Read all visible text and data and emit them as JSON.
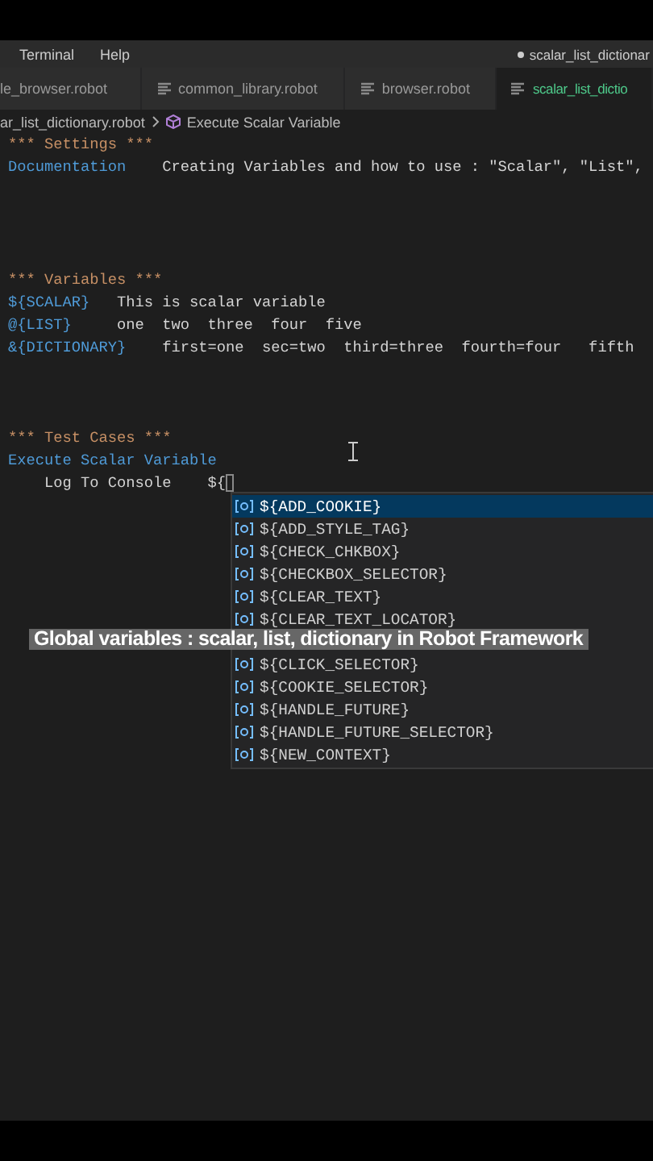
{
  "menu": [
    "Terminal",
    "Help"
  ],
  "window": {
    "title": "scalar_list_dictionar",
    "modified": true
  },
  "tabs": [
    {
      "label": "le_browser.robot",
      "icon": false,
      "selected": false
    },
    {
      "label": "common_library.robot",
      "icon": true,
      "selected": false
    },
    {
      "label": "browser.robot",
      "icon": true,
      "selected": false
    },
    {
      "label": "scalar_list_dictio",
      "icon": true,
      "selected": true
    }
  ],
  "breadcrumb": {
    "file": "ar_list_dictionary.robot",
    "symbol": "Execute Scalar Variable"
  },
  "editor": {
    "lines": [
      {
        "kind": "code",
        "tokens": [
          {
            "kind": "header",
            "text": "*** Settings ***"
          }
        ]
      },
      {
        "kind": "code",
        "tokens": [
          {
            "kind": "name",
            "text": "Documentation"
          },
          {
            "kind": "plain",
            "text": "    Creating Variables and how to use : \"Scalar\", \"List\","
          }
        ]
      },
      {
        "kind": "blank"
      },
      {
        "kind": "blank"
      },
      {
        "kind": "blank"
      },
      {
        "kind": "blank"
      },
      {
        "kind": "code",
        "tokens": [
          {
            "kind": "header",
            "text": "*** Variables ***"
          }
        ]
      },
      {
        "kind": "code",
        "tokens": [
          {
            "kind": "name",
            "text": "${SCALAR}"
          },
          {
            "kind": "plain",
            "text": "   This is scalar variable"
          }
        ]
      },
      {
        "kind": "code",
        "tokens": [
          {
            "kind": "name",
            "text": "@{LIST}"
          },
          {
            "kind": "plain",
            "text": "     one  two  three  four  five"
          }
        ]
      },
      {
        "kind": "code",
        "tokens": [
          {
            "kind": "name",
            "text": "&{DICTIONARY}"
          },
          {
            "kind": "plain",
            "text": "    first=one  sec=two  third=three  fourth=four   fifth"
          }
        ]
      },
      {
        "kind": "blank"
      },
      {
        "kind": "blank"
      },
      {
        "kind": "blank"
      },
      {
        "kind": "code",
        "tokens": [
          {
            "kind": "header",
            "text": "*** Test Cases ***"
          }
        ]
      },
      {
        "kind": "code",
        "tokens": [
          {
            "kind": "name",
            "text": "Execute Scalar Variable"
          }
        ]
      },
      {
        "kind": "code",
        "tokens": [
          {
            "kind": "plain",
            "text": "    Log To Console    "
          },
          {
            "kind": "plain",
            "text": "${"
          },
          {
            "kind": "cursor"
          }
        ]
      }
    ]
  },
  "suggestions": [
    {
      "text": "${ADD_COOKIE}",
      "selected": true
    },
    {
      "text": "${ADD_STYLE_TAG}",
      "selected": false
    },
    {
      "text": "${CHECK_CHKBOX}",
      "selected": false
    },
    {
      "text": "${CHECKBOX_SELECTOR}",
      "selected": false
    },
    {
      "text": "${CLEAR_TEXT}",
      "selected": false
    },
    {
      "text": "${CLEAR_TEXT_LOCATOR}",
      "selected": false
    },
    {
      "kind": "covered",
      "selected": false
    },
    {
      "text": "${CLICK_SELECTOR}",
      "selected": false
    },
    {
      "text": "${COOKIE_SELECTOR}",
      "selected": false
    },
    {
      "text": "${HANDLE_FUTURE}",
      "selected": false
    },
    {
      "text": "${HANDLE_FUTURE_SELECTOR}",
      "selected": false
    },
    {
      "text": "${NEW_CONTEXT}",
      "selected": false
    }
  ],
  "caption": "Global variables : scalar, list, dictionary in Robot Framework"
}
